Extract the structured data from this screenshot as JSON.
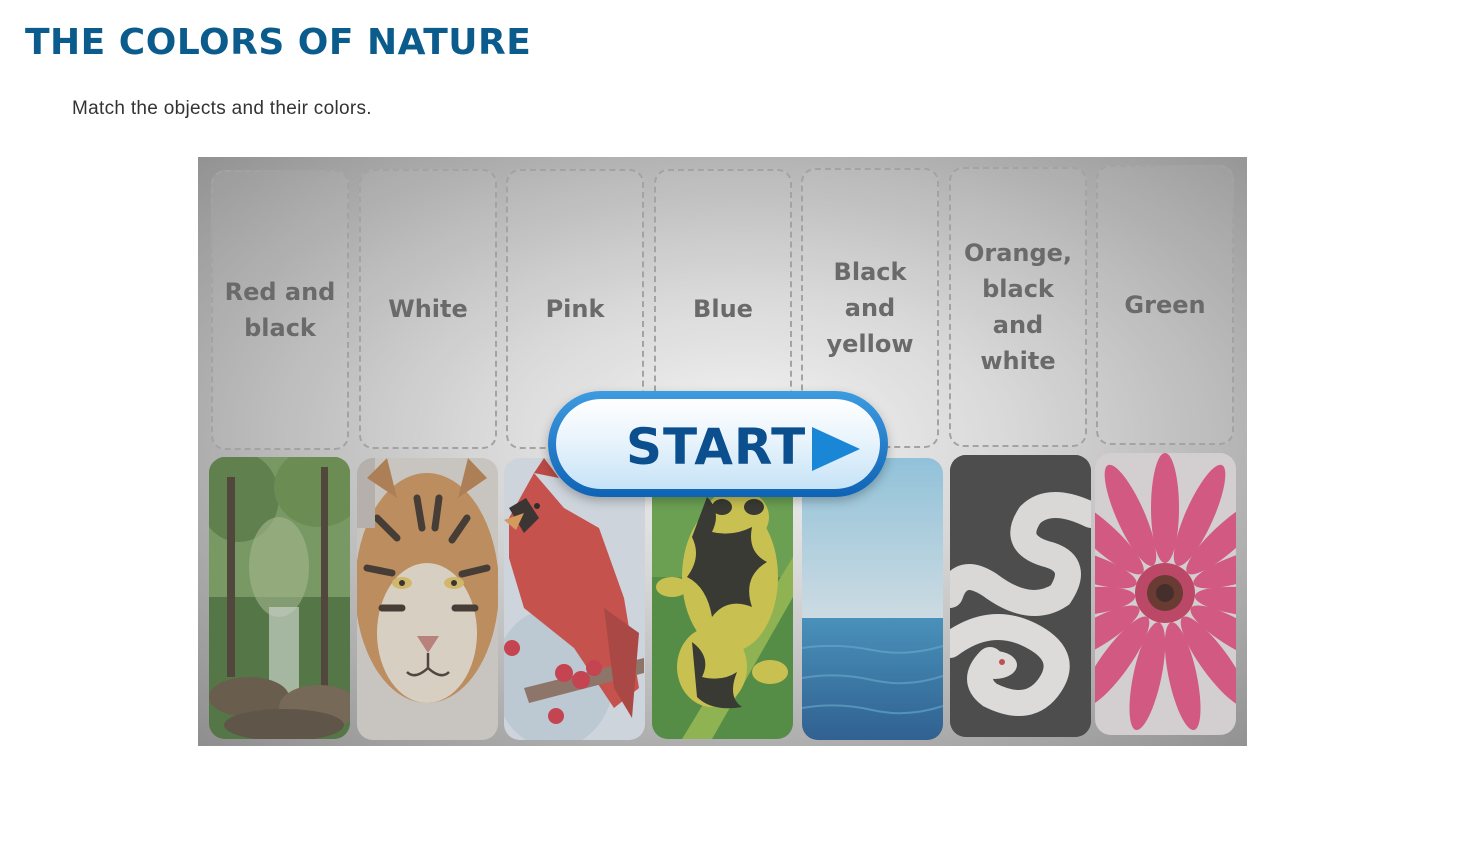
{
  "page": {
    "title": "THE COLORS OF NATURE",
    "instructions": "Match the objects and their colors."
  },
  "game": {
    "labels": [
      "Red and\nblack",
      "White",
      "Pink",
      "Blue",
      "Black and\nyellow",
      "Orange,\nblack\nand  white",
      "Green"
    ],
    "photos": [
      {
        "name": "forest",
        "icon": "forest-photo"
      },
      {
        "name": "tiger",
        "icon": "tiger-photo"
      },
      {
        "name": "cardinal-bird",
        "icon": "cardinal-photo"
      },
      {
        "name": "poison-frog",
        "icon": "frog-photo"
      },
      {
        "name": "sea-and-sky",
        "icon": "sea-photo"
      },
      {
        "name": "white-snake",
        "icon": "snake-photo"
      },
      {
        "name": "pink-flower",
        "icon": "flower-photo"
      }
    ],
    "start_label": "START",
    "start_icon": "play-icon",
    "colors": {
      "title": "#0b5c8c",
      "start_text": "#0b4f8f",
      "start_border": "#1a78c8"
    }
  }
}
